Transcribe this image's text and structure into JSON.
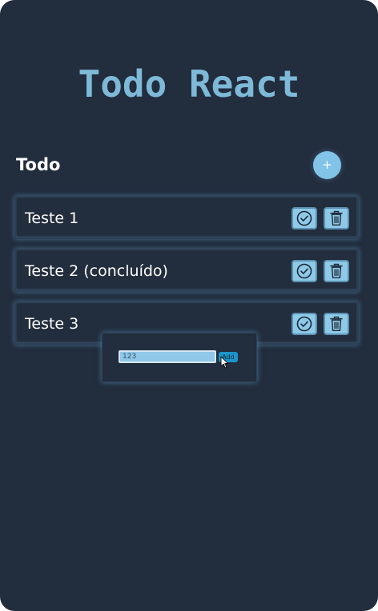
{
  "app": {
    "title": "Todo React"
  },
  "section": {
    "title": "Todo",
    "add_button_label": "+"
  },
  "todos": [
    {
      "label": "Teste 1",
      "done": false
    },
    {
      "label": "Teste 2 (concluído)",
      "done": true
    },
    {
      "label": "Teste 3",
      "done": false
    }
  ],
  "popup": {
    "input_value": "123",
    "add_label": "Add"
  },
  "icons": {
    "complete": "check-circle-icon",
    "delete": "trash-icon",
    "cursor": "mouse-pointer-icon"
  },
  "colors": {
    "background": "#222d3d",
    "accent": "#7eb9d8",
    "button": "#8ec9e8",
    "add_button": "#1b95c9"
  }
}
